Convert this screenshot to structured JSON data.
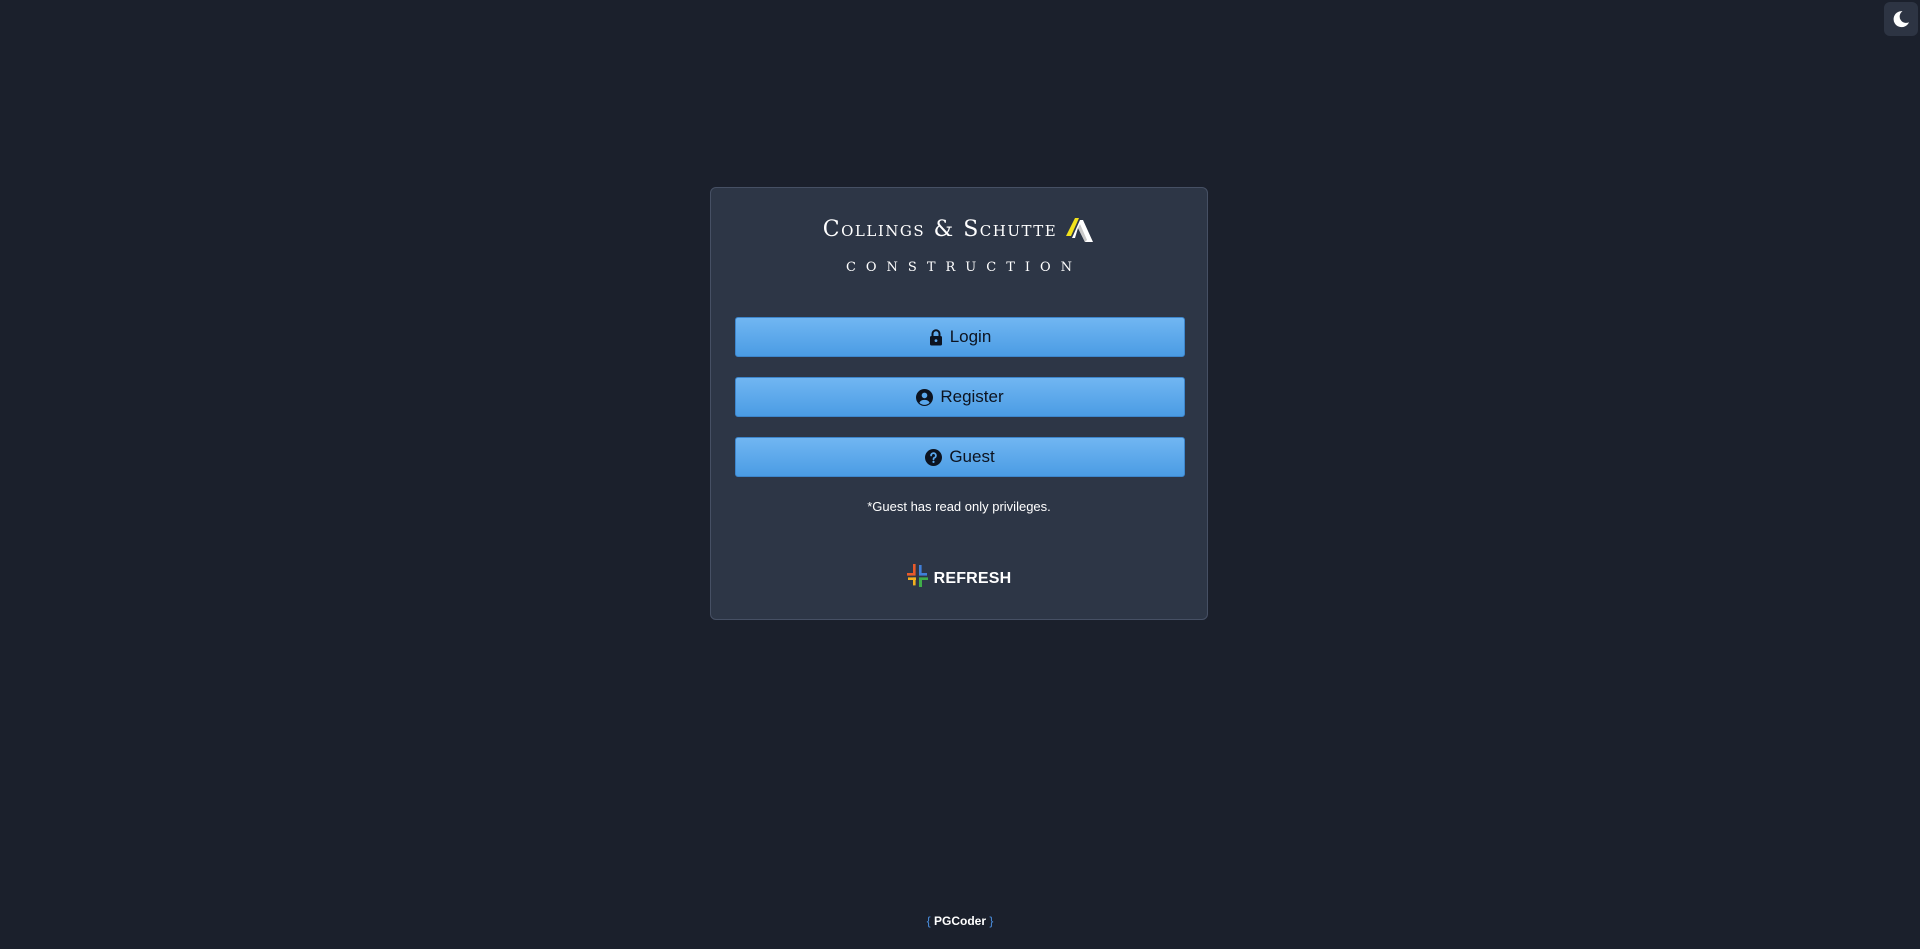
{
  "theme_toggle": {
    "icon": "moon-icon"
  },
  "logo": {
    "brand": "Collings & Schutte",
    "subtitle": "CONSTRUCTION",
    "mark_colors": [
      "#f2e21c",
      "#ffffff"
    ]
  },
  "buttons": {
    "login": {
      "label": "Login",
      "icon": "lock-icon"
    },
    "register": {
      "label": "Register",
      "icon": "user-circle-icon"
    },
    "guest": {
      "label": "Guest",
      "icon": "question-circle-icon"
    }
  },
  "guest_note": "*Guest has read only privileges.",
  "refresh": {
    "label": "REFRESH",
    "icon": "refresh-logo-icon"
  },
  "footer": {
    "open_brace": "{",
    "credit": "PGCoder",
    "close_brace": "}"
  },
  "colors": {
    "background": "#1b202c",
    "card": "#2d3646",
    "button": "#5aa7ec",
    "button_text": "#0c1320"
  }
}
